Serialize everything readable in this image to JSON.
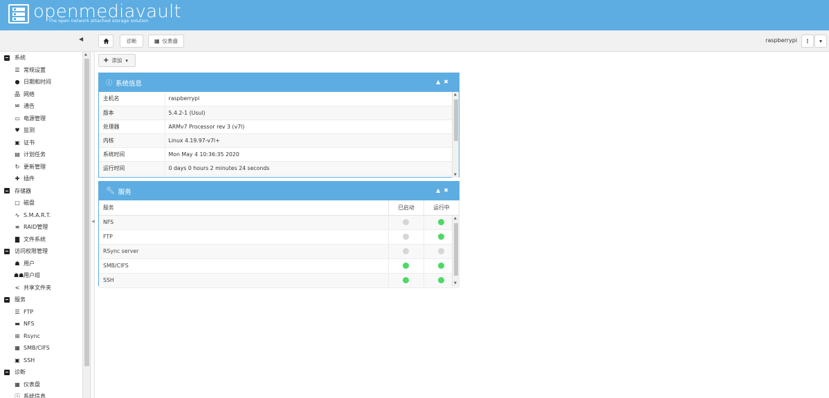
{
  "header": {
    "logo_text": "openmediavault",
    "logo_subtitle": "The open network attached storage solution"
  },
  "toolbar": {
    "collapse_glyph": "◀",
    "home_icon": "home-icon",
    "breadcrumb_1": "诊断",
    "breadcrumb_2": "仪表盘",
    "user": "raspberrypi",
    "menu_glyph": "⋮",
    "dropdown_glyph": "▾"
  },
  "sidebar": {
    "items": [
      {
        "type": "cat",
        "label": "系统",
        "icon": "minus-square-icon",
        "glyph": ""
      },
      {
        "type": "sub",
        "label": "常规设置",
        "icon": "sliders-icon",
        "glyph": "☰"
      },
      {
        "type": "sub",
        "label": "日期和时间",
        "icon": "clock-icon",
        "glyph": "●"
      },
      {
        "type": "sub",
        "label": "网络",
        "icon": "network-icon",
        "glyph": "品"
      },
      {
        "type": "sub",
        "label": "通告",
        "icon": "envelope-icon",
        "glyph": "✉"
      },
      {
        "type": "sub",
        "label": "电源管理",
        "icon": "battery-icon",
        "glyph": "▭"
      },
      {
        "type": "sub",
        "label": "监测",
        "icon": "heartbeat-icon",
        "glyph": "♥"
      },
      {
        "type": "sub",
        "label": "证书",
        "icon": "certificate-icon",
        "glyph": "▣"
      },
      {
        "type": "sub",
        "label": "计划任务",
        "icon": "calendar-icon",
        "glyph": "▤"
      },
      {
        "type": "sub",
        "label": "更新管理",
        "icon": "refresh-icon",
        "glyph": "↻"
      },
      {
        "type": "sub",
        "label": "插件",
        "icon": "puzzle-icon",
        "glyph": "✚"
      },
      {
        "type": "cat",
        "label": "存储器",
        "icon": "minus-square-icon",
        "glyph": ""
      },
      {
        "type": "sub",
        "label": "磁盘",
        "icon": "disk-icon",
        "glyph": "▢"
      },
      {
        "type": "sub",
        "label": "S.M.A.R.T.",
        "icon": "pulse-icon",
        "glyph": "∿"
      },
      {
        "type": "sub",
        "label": "RAID管理",
        "icon": "database-icon",
        "glyph": "≡"
      },
      {
        "type": "sub",
        "label": "文件系统",
        "icon": "folder-icon",
        "glyph": "▇"
      },
      {
        "type": "cat",
        "label": "访问权限管理",
        "icon": "minus-square-icon",
        "glyph": ""
      },
      {
        "type": "sub",
        "label": "用户",
        "icon": "user-icon",
        "glyph": "☗"
      },
      {
        "type": "sub",
        "label": "用户组",
        "icon": "users-icon",
        "glyph": "☗☗"
      },
      {
        "type": "sub",
        "label": "共享文件夹",
        "icon": "share-icon",
        "glyph": "<"
      },
      {
        "type": "cat",
        "label": "服务",
        "icon": "minus-square-icon",
        "glyph": ""
      },
      {
        "type": "sub",
        "label": "FTP",
        "icon": "server-icon",
        "glyph": "☰"
      },
      {
        "type": "sub",
        "label": "NFS",
        "icon": "desktop-icon",
        "glyph": "▬"
      },
      {
        "type": "sub",
        "label": "Rsync",
        "icon": "sitemap-icon",
        "glyph": "⊞"
      },
      {
        "type": "sub",
        "label": "SMB/CIFS",
        "icon": "windows-icon",
        "glyph": "▦"
      },
      {
        "type": "sub",
        "label": "SSH",
        "icon": "terminal-icon",
        "glyph": "▣"
      },
      {
        "type": "cat",
        "label": "诊断",
        "icon": "minus-square-icon",
        "glyph": ""
      },
      {
        "type": "sub",
        "label": "仪表盘",
        "icon": "dashboard-icon",
        "glyph": "▦"
      },
      {
        "type": "sub",
        "label": "系统信息",
        "icon": "info-icon",
        "glyph": "ⓘ"
      }
    ]
  },
  "main": {
    "add_label": "添加",
    "sysinfo": {
      "title": "系统信息",
      "controls": "▲✖",
      "rows": [
        {
          "k": "主机名",
          "v": "raspberrypi"
        },
        {
          "k": "版本",
          "v": "5.4.2-1 (Usul)"
        },
        {
          "k": "处理器",
          "v": "ARMv7 Processor rev 3 (v7l)"
        },
        {
          "k": "内核",
          "v": "Linux 4.19.97-v7l+"
        },
        {
          "k": "系统时间",
          "v": "Mon May 4 10:36:35 2020"
        },
        {
          "k": "运行时间",
          "v": "0 days 0 hours 2 minutes 24 seconds"
        }
      ]
    },
    "services": {
      "title": "服务",
      "controls": "▲✖",
      "col_name": "服务",
      "col_enabled": "已启动",
      "col_running": "运行中",
      "rows": [
        {
          "name": "NFS",
          "enabled": false,
          "running": true
        },
        {
          "name": "FTP",
          "enabled": false,
          "running": true
        },
        {
          "name": "RSync server",
          "enabled": false,
          "running": false
        },
        {
          "name": "SMB/CIFS",
          "enabled": true,
          "running": true
        },
        {
          "name": "SSH",
          "enabled": true,
          "running": true
        }
      ]
    }
  },
  "colors": {
    "accent": "#5dade2",
    "on": "#4cd964",
    "off": "#d6d6d6"
  }
}
